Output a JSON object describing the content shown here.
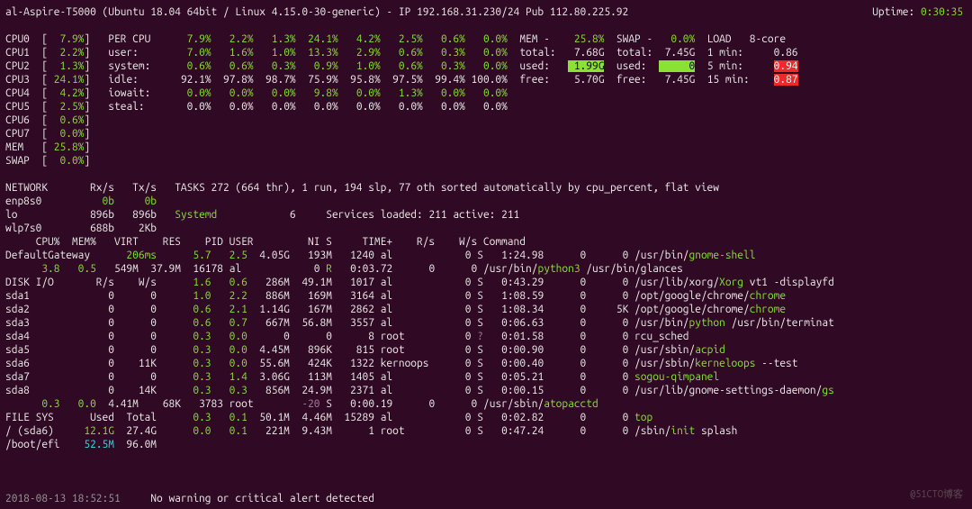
{
  "header": {
    "host": "al-Aspire-T5000",
    "os": "Ubuntu 18.04 64bit",
    "kernel": "Linux 4.15.0-30-generic",
    "ip": "192.168.31.230/24",
    "pub": "112.80.225.92",
    "uptime": "0:30:35"
  },
  "left_col": [
    {
      "k": "CPU0",
      "v": "7.9%",
      "c": "g"
    },
    {
      "k": "CPU1",
      "v": "2.2%",
      "c": "g"
    },
    {
      "k": "CPU2",
      "v": "1.3%",
      "c": "g"
    },
    {
      "k": "CPU3",
      "v": "24.1%",
      "c": "g"
    },
    {
      "k": "CPU4",
      "v": "4.2%",
      "c": "g"
    },
    {
      "k": "CPU5",
      "v": "2.5%",
      "c": "g"
    },
    {
      "k": "CPU6",
      "v": "0.6%",
      "c": "g"
    },
    {
      "k": "CPU7",
      "v": "0.0%",
      "c": "g"
    },
    {
      "k": "MEM",
      "v": "25.8%",
      "c": "g"
    },
    {
      "k": "SWAP",
      "v": "0.0%",
      "c": "g"
    }
  ],
  "per_cpu": {
    "header": "PER CPU",
    "rows": [
      {
        "label": "",
        "vals": [
          "7.9%",
          "2.2%",
          "1.3%",
          "24.1%",
          "4.2%",
          "2.5%",
          "0.6%",
          "0.0%"
        ],
        "c": "g"
      },
      {
        "label": "user:",
        "vals": [
          "7.0%",
          "1.6%",
          "1.0%",
          "13.3%",
          "2.9%",
          "0.6%",
          "0.3%",
          "0.0%"
        ],
        "c": "g"
      },
      {
        "label": "system:",
        "vals": [
          "0.6%",
          "0.6%",
          "0.3%",
          "0.9%",
          "1.0%",
          "0.6%",
          "0.3%",
          "0.0%"
        ],
        "c": "g"
      },
      {
        "label": "idle:",
        "vals": [
          "92.1%",
          "97.8%",
          "98.7%",
          "75.9%",
          "95.8%",
          "97.5%",
          "99.4%",
          "100.0%"
        ],
        "c": "w"
      },
      {
        "label": "iowait:",
        "vals": [
          "0.0%",
          "0.0%",
          "0.0%",
          "9.8%",
          "0.0%",
          "1.3%",
          "0.0%",
          "0.0%"
        ],
        "c": "g"
      },
      {
        "label": "steal:",
        "vals": [
          "0.0%",
          "0.0%",
          "0.0%",
          "0.0%",
          "0.0%",
          "0.0%",
          "0.0%",
          "0.0%"
        ],
        "c": "w"
      }
    ]
  },
  "mem": {
    "title": "MEM -",
    "pct": "25.8%",
    "total": "7.68G",
    "used": "1.99G",
    "free": "5.70G"
  },
  "swap": {
    "title": "SWAP -",
    "pct": "0.0%",
    "total": "7.45G",
    "used": "0",
    "free": "7.45G"
  },
  "load": {
    "title": "LOAD",
    "cores": "8-core",
    "m1": "0.86",
    "m5": "0.94",
    "m15": "0.87"
  },
  "network": {
    "title": "NETWORK",
    "rx": "Rx/s",
    "tx": "Tx/s",
    "ifs": [
      {
        "n": "enp8s0",
        "rx": "0b",
        "tx": "0b",
        "c": "g"
      },
      {
        "n": "lo",
        "rx": "896b",
        "tx": "896b",
        "c": "w"
      },
      {
        "n": "wlp7s0",
        "rx": "688b",
        "tx": "2Kb",
        "c": "w"
      }
    ]
  },
  "gateway": {
    "label": "DefaultGateway",
    "val": "206ms"
  },
  "disk": {
    "title": "DISK I/O",
    "rh": "R/s",
    "wh": "W/s",
    "rows": [
      {
        "n": "sda1",
        "r": "0",
        "w": "0"
      },
      {
        "n": "sda2",
        "r": "0",
        "w": "0"
      },
      {
        "n": "sda3",
        "r": "0",
        "w": "0"
      },
      {
        "n": "sda4",
        "r": "0",
        "w": "0"
      },
      {
        "n": "sda5",
        "r": "0",
        "w": "0"
      },
      {
        "n": "sda6",
        "r": "0",
        "w": "11K"
      },
      {
        "n": "sda7",
        "r": "0",
        "w": "0"
      },
      {
        "n": "sda8",
        "r": "0",
        "w": "14K"
      }
    ]
  },
  "fs": {
    "title": "FILE SYS",
    "uh": "Used",
    "th": "Total",
    "rows": [
      {
        "n": "/ (sda6)",
        "u": "12.1G",
        "t": "27.4G",
        "c": "g"
      },
      {
        "n": "/boot/efi",
        "u": "52.5M",
        "t": "96.0M",
        "c": "c"
      }
    ]
  },
  "tasks": "TASKS 272 (664 thr), 1 run, 194 slp, 77 oth sorted automatically by cpu_percent, flat view",
  "systemd": {
    "label": "Systemd",
    "val": "6",
    "text": "Services loaded: 211 active: 211"
  },
  "proc_header": [
    "CPU%",
    "MEM%",
    "VIRT",
    "RES",
    "PID",
    "USER",
    "NI",
    "S",
    "TIME+",
    "R/s",
    "W/s",
    "Command"
  ],
  "procs": [
    {
      "cpu": "5.7",
      "mem": "2.5",
      "virt": "4.05G",
      "res": "193M",
      "pid": "1240",
      "user": "al",
      "ni": "0",
      "s": "S",
      "time": "1:24.98",
      "r": "0",
      "w": "0",
      "cmd": [
        {
          "t": "/usr/bin/",
          "c": "w"
        },
        {
          "t": "gnome-shell",
          "c": "g"
        }
      ]
    },
    {
      "cpu": "3.8",
      "mem": "0.5",
      "virt": "549M",
      "res": "37.9M",
      "pid": "16178",
      "user": "al",
      "ni": "0",
      "s": "R",
      "time": "0:03.72",
      "r": "0",
      "w": "0",
      "cmd": [
        {
          "t": "/usr/bin/",
          "c": "w"
        },
        {
          "t": "python3",
          "c": "g"
        },
        {
          "t": " /usr/bin/glances",
          "c": "w"
        }
      ]
    },
    {
      "cpu": "1.6",
      "mem": "0.6",
      "virt": "286M",
      "res": "49.1M",
      "pid": "1017",
      "user": "al",
      "ni": "0",
      "s": "S",
      "time": "0:43.29",
      "r": "0",
      "w": "0",
      "cmd": [
        {
          "t": "/usr/lib/xorg/",
          "c": "w"
        },
        {
          "t": "Xorg",
          "c": "g"
        },
        {
          "t": " vt1 -displayfd",
          "c": "w"
        }
      ]
    },
    {
      "cpu": "1.0",
      "mem": "2.2",
      "virt": "886M",
      "res": "169M",
      "pid": "3164",
      "user": "al",
      "ni": "0",
      "s": "S",
      "time": "1:08.59",
      "r": "0",
      "w": "0",
      "cmd": [
        {
          "t": "/opt/google/chrome/",
          "c": "w"
        },
        {
          "t": "chrome",
          "c": "g"
        }
      ]
    },
    {
      "cpu": "0.6",
      "mem": "2.1",
      "virt": "1.14G",
      "res": "167M",
      "pid": "2862",
      "user": "al",
      "ni": "0",
      "s": "S",
      "time": "1:08.34",
      "r": "0",
      "w": "5K",
      "cmd": [
        {
          "t": "/opt/google/chrome/",
          "c": "w"
        },
        {
          "t": "chrome",
          "c": "g"
        }
      ]
    },
    {
      "cpu": "0.6",
      "mem": "0.7",
      "virt": "667M",
      "res": "56.8M",
      "pid": "3557",
      "user": "al",
      "ni": "0",
      "s": "S",
      "time": "0:06.63",
      "r": "0",
      "w": "0",
      "cmd": [
        {
          "t": "/usr/bin/",
          "c": "w"
        },
        {
          "t": "python",
          "c": "g"
        },
        {
          "t": " /usr/bin/terminat",
          "c": "w"
        }
      ]
    },
    {
      "cpu": "0.3",
      "mem": "0.0",
      "virt": "0",
      "res": "0",
      "pid": "8",
      "user": "root",
      "ni": "0",
      "s": "?",
      "time": "0:01.58",
      "r": "0",
      "w": "0",
      "cmd": [
        {
          "t": "rcu_sched",
          "c": "w"
        }
      ]
    },
    {
      "cpu": "0.3",
      "mem": "0.0",
      "virt": "4.45M",
      "res": "896K",
      "pid": "815",
      "user": "root",
      "ni": "0",
      "s": "S",
      "time": "0:00.90",
      "r": "0",
      "w": "0",
      "cmd": [
        {
          "t": "/usr/sbin/",
          "c": "w"
        },
        {
          "t": "acpid",
          "c": "g"
        }
      ]
    },
    {
      "cpu": "0.3",
      "mem": "0.0",
      "virt": "55.6M",
      "res": "424K",
      "pid": "1322",
      "user": "kernoops",
      "ni": "0",
      "s": "S",
      "time": "0:00.40",
      "r": "0",
      "w": "0",
      "cmd": [
        {
          "t": "/usr/sbin/",
          "c": "w"
        },
        {
          "t": "kerneloops",
          "c": "g"
        },
        {
          "t": " --test",
          "c": "w"
        }
      ]
    },
    {
      "cpu": "0.3",
      "mem": "1.4",
      "virt": "3.06G",
      "res": "113M",
      "pid": "1405",
      "user": "al",
      "ni": "0",
      "s": "S",
      "time": "0:05.21",
      "r": "0",
      "w": "0",
      "cmd": [
        {
          "t": "sogou-qimpanel",
          "c": "g"
        }
      ]
    },
    {
      "cpu": "0.3",
      "mem": "0.3",
      "virt": "856M",
      "res": "24.9M",
      "pid": "2371",
      "user": "al",
      "ni": "0",
      "s": "S",
      "time": "0:00.15",
      "r": "0",
      "w": "0",
      "cmd": [
        {
          "t": "/usr/lib/gnome-settings-daemon/",
          "c": "w"
        },
        {
          "t": "gs",
          "c": "g"
        }
      ]
    },
    {
      "cpu": "0.3",
      "mem": "0.0",
      "virt": "4.41M",
      "res": "68K",
      "pid": "3783",
      "user": "root",
      "ni": "-20",
      "s": "S",
      "time": "0:00.19",
      "r": "0",
      "w": "0",
      "cmd": [
        {
          "t": "/usr/sbin/",
          "c": "w"
        },
        {
          "t": "atopacctd",
          "c": "g"
        }
      ]
    },
    {
      "cpu": "0.3",
      "mem": "0.1",
      "virt": "50.1M",
      "res": "4.46M",
      "pid": "15289",
      "user": "al",
      "ni": "0",
      "s": "S",
      "time": "0:02.82",
      "r": "0",
      "w": "0",
      "cmd": [
        {
          "t": "top",
          "c": "g"
        }
      ]
    },
    {
      "cpu": "0.0",
      "mem": "0.1",
      "virt": "221M",
      "res": "9.43M",
      "pid": "1",
      "user": "root",
      "ni": "0",
      "s": "S",
      "time": "0:47.24",
      "r": "0",
      "w": "0",
      "cmd": [
        {
          "t": "/sbin/",
          "c": "w"
        },
        {
          "t": "init",
          "c": "g"
        },
        {
          "t": " splash",
          "c": "w"
        }
      ]
    }
  ],
  "footer": {
    "ts": "2018-08-13 18:52:51",
    "msg": "No warning or critical alert detected"
  },
  "watermark": "@51CTO博客"
}
